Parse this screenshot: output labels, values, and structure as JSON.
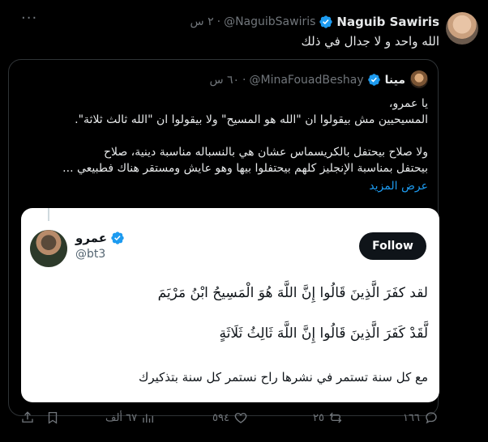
{
  "tweet": {
    "author_name": "Naguib Sawiris",
    "author_handle": "@NaguibSawiris",
    "time": "٢ س",
    "text": "الله واحد و لا جدال في ذلك",
    "more": "···"
  },
  "quoted": {
    "author_name": "مينا",
    "author_handle": "@MinaFouadBeshay",
    "time": "٦٠ س",
    "lines": [
      "يا عمرو،",
      "المسيحيين مش بيقولوا ان \"الله هو المسيح\" ولا بيقولوا ان \"الله ثالث ثلاثة\".",
      "",
      "ولا صلاح بيحتفل بالكريسماس عشان هي بالنسباله مناسبة دينية، صلاح",
      "بيحتفل بمناسبة الإنجليز كلهم بيحتفلوا بيها وهو عايش ومستقر هناك فطبيعي ..."
    ],
    "show_more": "عرض المزيد"
  },
  "embed": {
    "name": "عمرو",
    "handle": "@bt3",
    "follow_label": "Follow",
    "line1": "لقد كفَرَ الَّذِينَ قَالُوا إِنَّ اللَّهَ هُوَ الْمَسِيحُ ابْنُ مَرْيَمَ",
    "line2": "لَّقَدْ كَفَرَ الَّذِينَ قَالُوا إِنَّ اللَّهَ ثَالِثُ ثَلَاثَةٍ",
    "line3": "مع كل سنة تستمر في نشرها راح نستمر كل سنة بتذكيرك"
  },
  "actions": {
    "replies": "١٦٦",
    "retweets": "٢٥",
    "likes": "٥٩٤",
    "views": "٦٧ ألف"
  },
  "colors": {
    "verified": "#1d9bf0",
    "link": "#1d9bf0",
    "muted": "#71767b",
    "background": "#000000"
  },
  "icons": [
    "verified-icon",
    "more-icon",
    "reply-icon",
    "retweet-icon",
    "like-icon",
    "views-icon",
    "bookmark-icon",
    "share-icon"
  ]
}
